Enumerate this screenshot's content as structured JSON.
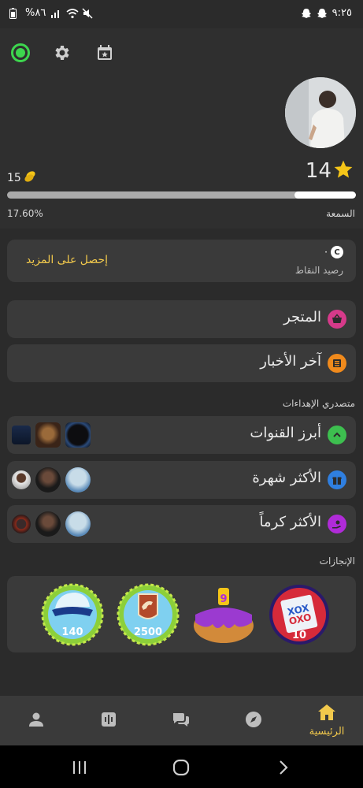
{
  "status_bar": {
    "time": "٩:٢٥",
    "battery": "%٨٦"
  },
  "profile": {
    "level": "14",
    "coins": "15",
    "progress_percent_label": "17.60%",
    "progress_fraction": 0.176,
    "reputation_label": "السمعة"
  },
  "points": {
    "get_more": "إحصل على المزيد",
    "value": "·",
    "label": "رصيد النقاط"
  },
  "menu": {
    "store": "المتجر",
    "news": "آخر الأخبار"
  },
  "gifts": {
    "title": "متصدري الإهداءات",
    "rows": [
      {
        "label": "أبرز القنوات",
        "icon": "chevron-up-icon",
        "color": "#3dbf4f"
      },
      {
        "label": "الأكثر شهرة",
        "icon": "gift-icon",
        "color": "#2f7fe0"
      },
      {
        "label": "الأكثر كرماً",
        "icon": "hand-coin-icon",
        "color": "#b02bd8"
      }
    ]
  },
  "achievements": {
    "title": "الإنجازات",
    "badges": [
      {
        "icon": "tic-tac-toe-icon",
        "count": "10"
      },
      {
        "icon": "cake-icon",
        "count": "9"
      },
      {
        "icon": "horse-icon",
        "count": "2500"
      },
      {
        "icon": "cap-icon",
        "count": "140"
      }
    ]
  },
  "bottom_nav": {
    "home_label": "الرئيسية"
  },
  "colors": {
    "accent": "#f2c94c",
    "online": "#3dd64e"
  }
}
